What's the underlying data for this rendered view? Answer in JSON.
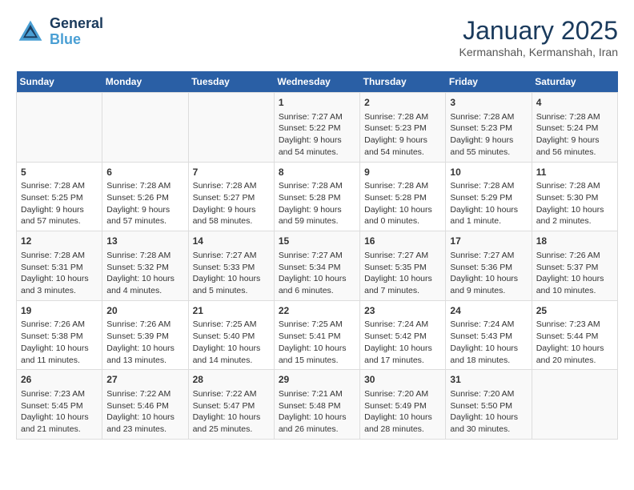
{
  "header": {
    "logo_line1": "General",
    "logo_line2": "Blue",
    "title": "January 2025",
    "subtitle": "Kermanshah, Kermanshah, Iran"
  },
  "days_of_week": [
    "Sunday",
    "Monday",
    "Tuesday",
    "Wednesday",
    "Thursday",
    "Friday",
    "Saturday"
  ],
  "weeks": [
    [
      {
        "day": "",
        "sunrise": "",
        "sunset": "",
        "daylight": ""
      },
      {
        "day": "",
        "sunrise": "",
        "sunset": "",
        "daylight": ""
      },
      {
        "day": "",
        "sunrise": "",
        "sunset": "",
        "daylight": ""
      },
      {
        "day": "1",
        "sunrise": "Sunrise: 7:27 AM",
        "sunset": "Sunset: 5:22 PM",
        "daylight": "Daylight: 9 hours and 54 minutes."
      },
      {
        "day": "2",
        "sunrise": "Sunrise: 7:28 AM",
        "sunset": "Sunset: 5:23 PM",
        "daylight": "Daylight: 9 hours and 54 minutes."
      },
      {
        "day": "3",
        "sunrise": "Sunrise: 7:28 AM",
        "sunset": "Sunset: 5:23 PM",
        "daylight": "Daylight: 9 hours and 55 minutes."
      },
      {
        "day": "4",
        "sunrise": "Sunrise: 7:28 AM",
        "sunset": "Sunset: 5:24 PM",
        "daylight": "Daylight: 9 hours and 56 minutes."
      }
    ],
    [
      {
        "day": "5",
        "sunrise": "Sunrise: 7:28 AM",
        "sunset": "Sunset: 5:25 PM",
        "daylight": "Daylight: 9 hours and 57 minutes."
      },
      {
        "day": "6",
        "sunrise": "Sunrise: 7:28 AM",
        "sunset": "Sunset: 5:26 PM",
        "daylight": "Daylight: 9 hours and 57 minutes."
      },
      {
        "day": "7",
        "sunrise": "Sunrise: 7:28 AM",
        "sunset": "Sunset: 5:27 PM",
        "daylight": "Daylight: 9 hours and 58 minutes."
      },
      {
        "day": "8",
        "sunrise": "Sunrise: 7:28 AM",
        "sunset": "Sunset: 5:28 PM",
        "daylight": "Daylight: 9 hours and 59 minutes."
      },
      {
        "day": "9",
        "sunrise": "Sunrise: 7:28 AM",
        "sunset": "Sunset: 5:28 PM",
        "daylight": "Daylight: 10 hours and 0 minutes."
      },
      {
        "day": "10",
        "sunrise": "Sunrise: 7:28 AM",
        "sunset": "Sunset: 5:29 PM",
        "daylight": "Daylight: 10 hours and 1 minute."
      },
      {
        "day": "11",
        "sunrise": "Sunrise: 7:28 AM",
        "sunset": "Sunset: 5:30 PM",
        "daylight": "Daylight: 10 hours and 2 minutes."
      }
    ],
    [
      {
        "day": "12",
        "sunrise": "Sunrise: 7:28 AM",
        "sunset": "Sunset: 5:31 PM",
        "daylight": "Daylight: 10 hours and 3 minutes."
      },
      {
        "day": "13",
        "sunrise": "Sunrise: 7:28 AM",
        "sunset": "Sunset: 5:32 PM",
        "daylight": "Daylight: 10 hours and 4 minutes."
      },
      {
        "day": "14",
        "sunrise": "Sunrise: 7:27 AM",
        "sunset": "Sunset: 5:33 PM",
        "daylight": "Daylight: 10 hours and 5 minutes."
      },
      {
        "day": "15",
        "sunrise": "Sunrise: 7:27 AM",
        "sunset": "Sunset: 5:34 PM",
        "daylight": "Daylight: 10 hours and 6 minutes."
      },
      {
        "day": "16",
        "sunrise": "Sunrise: 7:27 AM",
        "sunset": "Sunset: 5:35 PM",
        "daylight": "Daylight: 10 hours and 7 minutes."
      },
      {
        "day": "17",
        "sunrise": "Sunrise: 7:27 AM",
        "sunset": "Sunset: 5:36 PM",
        "daylight": "Daylight: 10 hours and 9 minutes."
      },
      {
        "day": "18",
        "sunrise": "Sunrise: 7:26 AM",
        "sunset": "Sunset: 5:37 PM",
        "daylight": "Daylight: 10 hours and 10 minutes."
      }
    ],
    [
      {
        "day": "19",
        "sunrise": "Sunrise: 7:26 AM",
        "sunset": "Sunset: 5:38 PM",
        "daylight": "Daylight: 10 hours and 11 minutes."
      },
      {
        "day": "20",
        "sunrise": "Sunrise: 7:26 AM",
        "sunset": "Sunset: 5:39 PM",
        "daylight": "Daylight: 10 hours and 13 minutes."
      },
      {
        "day": "21",
        "sunrise": "Sunrise: 7:25 AM",
        "sunset": "Sunset: 5:40 PM",
        "daylight": "Daylight: 10 hours and 14 minutes."
      },
      {
        "day": "22",
        "sunrise": "Sunrise: 7:25 AM",
        "sunset": "Sunset: 5:41 PM",
        "daylight": "Daylight: 10 hours and 15 minutes."
      },
      {
        "day": "23",
        "sunrise": "Sunrise: 7:24 AM",
        "sunset": "Sunset: 5:42 PM",
        "daylight": "Daylight: 10 hours and 17 minutes."
      },
      {
        "day": "24",
        "sunrise": "Sunrise: 7:24 AM",
        "sunset": "Sunset: 5:43 PM",
        "daylight": "Daylight: 10 hours and 18 minutes."
      },
      {
        "day": "25",
        "sunrise": "Sunrise: 7:23 AM",
        "sunset": "Sunset: 5:44 PM",
        "daylight": "Daylight: 10 hours and 20 minutes."
      }
    ],
    [
      {
        "day": "26",
        "sunrise": "Sunrise: 7:23 AM",
        "sunset": "Sunset: 5:45 PM",
        "daylight": "Daylight: 10 hours and 21 minutes."
      },
      {
        "day": "27",
        "sunrise": "Sunrise: 7:22 AM",
        "sunset": "Sunset: 5:46 PM",
        "daylight": "Daylight: 10 hours and 23 minutes."
      },
      {
        "day": "28",
        "sunrise": "Sunrise: 7:22 AM",
        "sunset": "Sunset: 5:47 PM",
        "daylight": "Daylight: 10 hours and 25 minutes."
      },
      {
        "day": "29",
        "sunrise": "Sunrise: 7:21 AM",
        "sunset": "Sunset: 5:48 PM",
        "daylight": "Daylight: 10 hours and 26 minutes."
      },
      {
        "day": "30",
        "sunrise": "Sunrise: 7:20 AM",
        "sunset": "Sunset: 5:49 PM",
        "daylight": "Daylight: 10 hours and 28 minutes."
      },
      {
        "day": "31",
        "sunrise": "Sunrise: 7:20 AM",
        "sunset": "Sunset: 5:50 PM",
        "daylight": "Daylight: 10 hours and 30 minutes."
      },
      {
        "day": "",
        "sunrise": "",
        "sunset": "",
        "daylight": ""
      }
    ]
  ]
}
